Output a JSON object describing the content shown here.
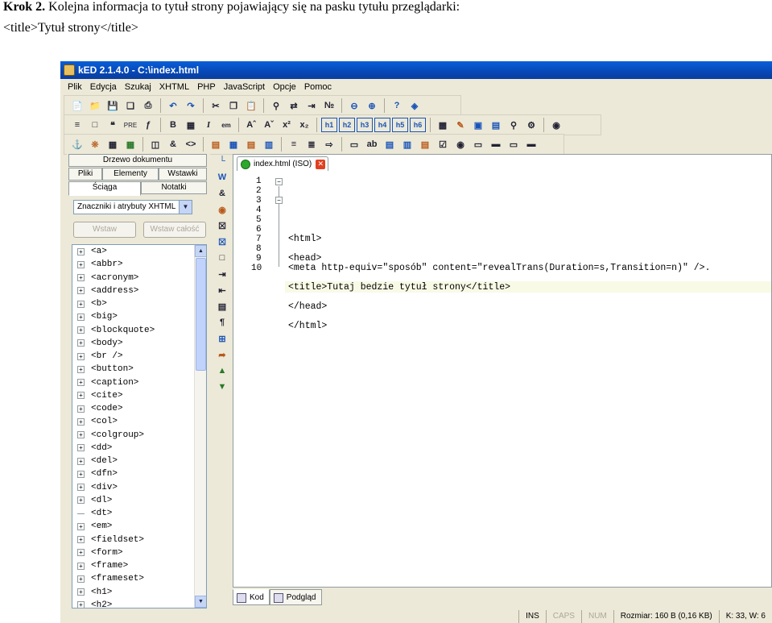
{
  "doc": {
    "step_label": "Krok 2.",
    "step_text": " Kolejna informacja to tytuł strony pojawiający się na pasku tytułu przeglądarki:",
    "code_example": "<title>Tytuł strony</title>"
  },
  "window": {
    "title": "kED 2.1.4.0 - C:\\index.html"
  },
  "menu": [
    "Plik",
    "Edycja",
    "Szukaj",
    "XHTML",
    "PHP",
    "JavaScript",
    "Opcje",
    "Pomoc"
  ],
  "left_panel": {
    "tabs_row1": [
      "Drzewo dokumentu"
    ],
    "tabs_row2": [
      "Pliki",
      "Elementy",
      "Wstawki"
    ],
    "tabs_row3": [
      "Ściąga",
      "Notatki"
    ],
    "select_value": "Znaczniki i atrybuty XHTML",
    "insert_button": "Wstaw",
    "insert_all_button": "Wstaw całość",
    "tags": [
      "<a>",
      "<abbr>",
      "<acronym>",
      "<address>",
      "<b>",
      "<big>",
      "<blockquote>",
      "<body>",
      "<br />",
      "<button>",
      "<caption>",
      "<cite>",
      "<code>",
      "<col>",
      "<colgroup>",
      "<dd>",
      "<del>",
      "<dfn>",
      "<div>",
      "<dl>",
      "<dt>",
      "<em>",
      "<fieldset>",
      "<form>",
      "<frame>",
      "<frameset>",
      "<h1>",
      "<h2>"
    ]
  },
  "toolbar": {
    "pre_label": "PRE",
    "bold_label": "B",
    "italic_label": "I",
    "em_label": "em",
    "headings": [
      "h1",
      "h2",
      "h3",
      "h4",
      "h5",
      "h6"
    ]
  },
  "editor": {
    "tab_label": "index.html (ISO)",
    "line_numbers": [
      "1",
      "2",
      "3",
      "4",
      "5",
      "6",
      "7",
      "8",
      "9",
      "10"
    ],
    "lines": [
      "<html>",
      "",
      "<head>",
      "<meta http-equiv=\"sposób\" content=\"revealTrans(Duration=s,Transition=n)\" />.",
      "",
      "<title>Tutaj bedzie tytuł strony</title>",
      "",
      "</head>",
      "",
      "</html>"
    ]
  },
  "bottom_tabs": [
    "Kod",
    "Podgląd"
  ],
  "status": {
    "ins": "INS",
    "caps": "CAPS",
    "num": "NUM",
    "size": "Rozmiar: 160 B (0,16 KB)",
    "pos": "K: 33, W: 6"
  }
}
